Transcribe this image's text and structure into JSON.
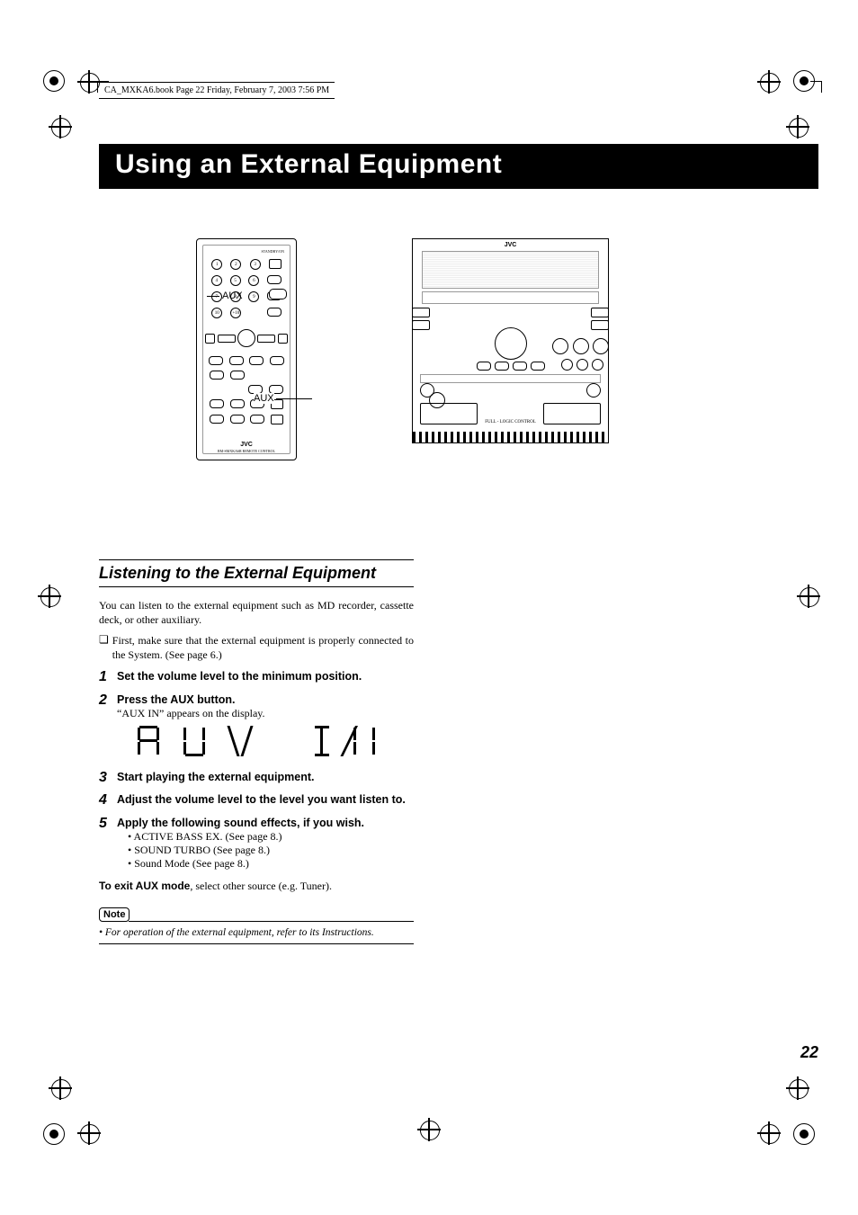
{
  "header": {
    "running": "CA_MXKA6.book  Page 22  Friday, February 7, 2003  7:56 PM"
  },
  "title": "Using an External Equipment",
  "diagrams": {
    "remote": {
      "aux_label": "AUX",
      "logo": "JVC",
      "sublogo": "RM-SMXKA6R  REMOTE CONTROL"
    },
    "system": {
      "aux_label": "AUX",
      "logo": "JVC"
    }
  },
  "section": {
    "title": "Listening to the External Equipment",
    "intro": "You can listen to the external equipment such as MD recorder, cassette deck, or other auxiliary.",
    "note_first": "First, make sure that the external equipment is properly connected to the System. (See page 6.)",
    "steps": [
      {
        "n": "1",
        "text": "Set the volume level to the minimum position."
      },
      {
        "n": "2",
        "text": "Press the AUX button.",
        "sub": "“AUX IN” appears on the display."
      },
      {
        "n": "3",
        "text": "Start playing the external equipment."
      },
      {
        "n": "4",
        "text": "Adjust the volume level to the level you want listen to."
      },
      {
        "n": "5",
        "text": "Apply the following sound effects, if you wish.",
        "bullets": [
          "ACTIVE BASS EX. (See page 8.)",
          "SOUND TURBO (See page 8.)",
          "Sound Mode (See page 8.)"
        ]
      }
    ],
    "display_text": "AUX  IN",
    "exit_bold": "To exit AUX mode",
    "exit_rest": ", select other source (e.g. Tuner).",
    "note_tag": "Note",
    "note_body": "For operation of the external equipment, refer to its Instructions."
  },
  "page_number": "22"
}
